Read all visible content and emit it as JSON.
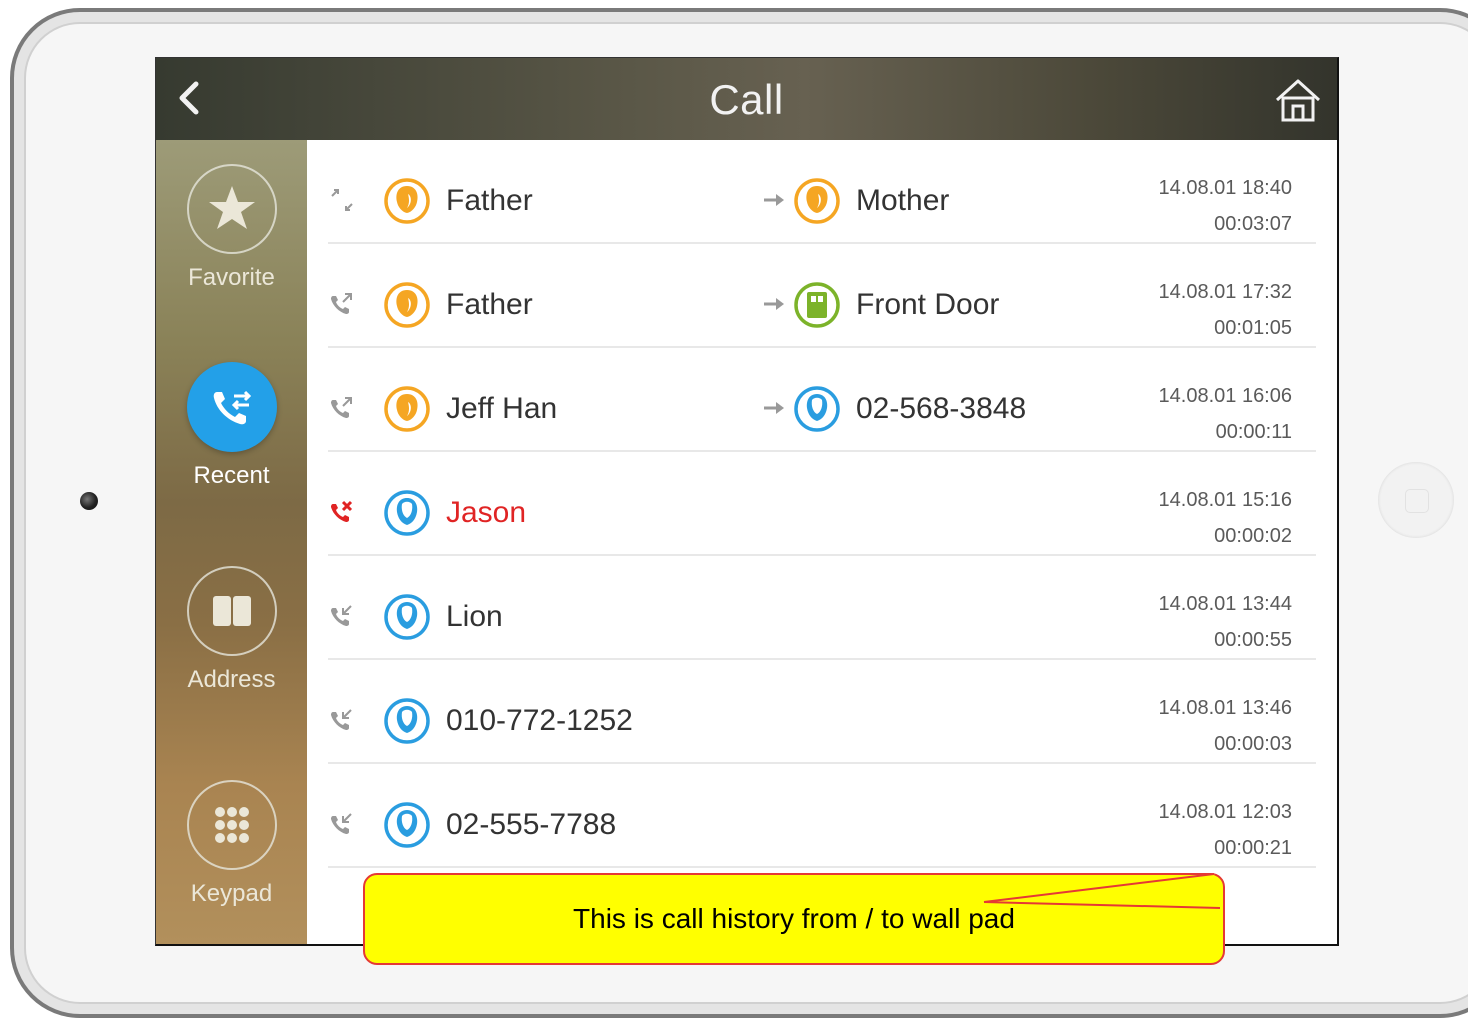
{
  "header": {
    "title": "Call"
  },
  "sidebar": {
    "items": [
      {
        "id": "favorite",
        "label": "Favorite",
        "icon": "star-icon",
        "active": false
      },
      {
        "id": "recent",
        "label": "Recent",
        "icon": "phone-transfer-icon",
        "active": true
      },
      {
        "id": "address",
        "label": "Address",
        "icon": "book-icon",
        "active": false
      },
      {
        "id": "keypad",
        "label": "Keypad",
        "icon": "keypad-icon",
        "active": false
      }
    ]
  },
  "calls": [
    {
      "type": "transfer",
      "caller": "Father",
      "caller_icon": "person-orange-icon",
      "callee": "Mother",
      "callee_icon": "person-orange-icon",
      "date": "14.08.01 18:40",
      "duration": "00:03:07"
    },
    {
      "type": "outgoing",
      "caller": "Father",
      "caller_icon": "person-orange-icon",
      "callee": "Front Door",
      "callee_icon": "door-green-icon",
      "date": "14.08.01 17:32",
      "duration": "00:01:05"
    },
    {
      "type": "outgoing",
      "caller": "Jeff Han",
      "caller_icon": "person-orange-icon",
      "callee": "02-568-3848",
      "callee_icon": "person-blue-icon",
      "date": "14.08.01 16:06",
      "duration": "00:00:11"
    },
    {
      "type": "missed",
      "caller": "Jason",
      "caller_icon": "person-blue-icon",
      "callee": "",
      "date": "14.08.01 15:16",
      "duration": "00:00:02"
    },
    {
      "type": "incoming",
      "caller": "Lion",
      "caller_icon": "person-blue-icon",
      "callee": "",
      "date": "14.08.01 13:44",
      "duration": "00:00:55"
    },
    {
      "type": "incoming",
      "caller": "010-772-1252",
      "caller_icon": "person-blue-icon",
      "callee": "",
      "date": "14.08.01 13:46",
      "duration": "00:00:03"
    },
    {
      "type": "incoming",
      "caller": "02-555-7788",
      "caller_icon": "person-blue-icon",
      "callee": "",
      "date": "14.08.01 12:03",
      "duration": "00:00:21"
    }
  ],
  "callout": {
    "text": "This is call history from / to wall pad"
  },
  "colors": {
    "accent": "#23a0e8",
    "missed": "#e02424",
    "orange_avatar": "#f5a623",
    "blue_avatar": "#2a9de0",
    "green_avatar": "#7cb32a",
    "callout_bg": "#ffff00",
    "callout_border": "#e53935"
  }
}
